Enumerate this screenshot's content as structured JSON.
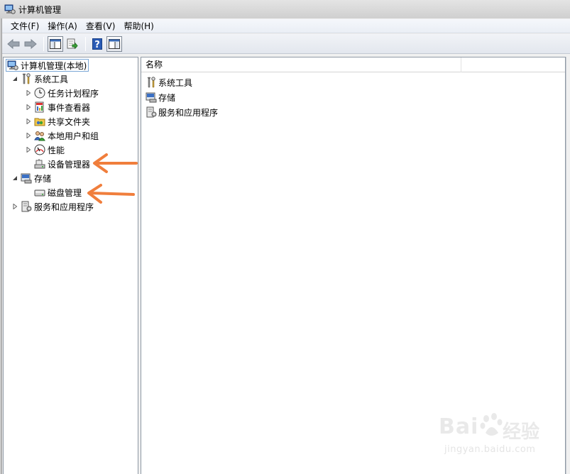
{
  "window": {
    "title": "计算机管理"
  },
  "menu": [
    "文件(F)",
    "操作(A)",
    "查看(V)",
    "帮助(H)"
  ],
  "toolbar": {
    "buttons": [
      "back-icon",
      "forward-icon",
      "show-hide-console-tree-icon",
      "export-list-icon",
      "help-icon",
      "show-hide-action-pane-icon"
    ]
  },
  "tree": {
    "root": "计算机管理(本地)",
    "system_tools": "系统工具",
    "task_scheduler": "任务计划程序",
    "event_viewer": "事件查看器",
    "shared_folders": "共享文件夹",
    "local_users_groups": "本地用户和组",
    "performance": "性能",
    "device_manager": "设备管理器",
    "storage": "存储",
    "disk_management": "磁盘管理",
    "services_apps": "服务和应用程序"
  },
  "list": {
    "column_name": "名称",
    "items": [
      "系统工具",
      "存储",
      "服务和应用程序"
    ]
  },
  "annotations": {
    "arrow_color": "#f07e3c"
  },
  "watermark": {
    "brand": "Bai",
    "cn": "经验",
    "url": "jingyan.baidu.com"
  }
}
